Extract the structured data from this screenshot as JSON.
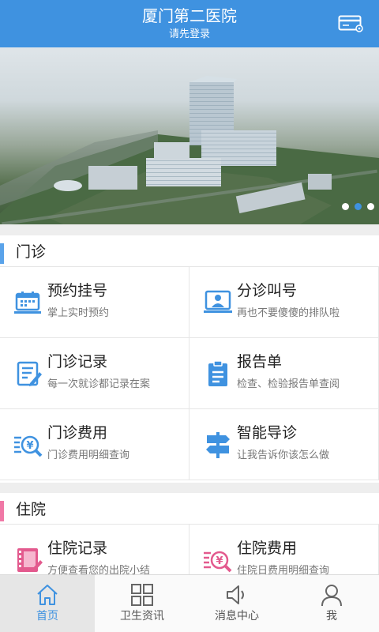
{
  "header": {
    "title": "厦门第二医院",
    "subtitle": "请先登录",
    "card_icon": "card-icon"
  },
  "banner": {
    "slide_count": 3,
    "active_slide": 2
  },
  "colors": {
    "primary": "#3f92e0",
    "outpatient_bar": "#5aa3ea",
    "inpatient_bar": "#f078a6",
    "inpatient_icon": "#e35a8e"
  },
  "outpatient": {
    "label": "门诊",
    "items": [
      {
        "title": "预约挂号",
        "subtitle": "掌上实时预约",
        "icon": "calendar-icon"
      },
      {
        "title": "分诊叫号",
        "subtitle": "再也不要傻傻的排队啦",
        "icon": "queue-icon"
      },
      {
        "title": "门诊记录",
        "subtitle": "每一次就诊都记录在案",
        "icon": "record-icon"
      },
      {
        "title": "报告单",
        "subtitle": "检查、检验报告单查阅",
        "icon": "report-icon"
      },
      {
        "title": "门诊费用",
        "subtitle": "门诊费用明细查询",
        "icon": "fee-search-icon"
      },
      {
        "title": "智能导诊",
        "subtitle": "让我告诉你该怎么做",
        "icon": "signpost-icon"
      }
    ]
  },
  "inpatient": {
    "label": "住院",
    "items": [
      {
        "title": "住院记录",
        "subtitle": "方便查看您的出院小结",
        "icon": "film-icon"
      },
      {
        "title": "住院费用",
        "subtitle": "住院日费用明细查询",
        "icon": "fee-search-icon"
      }
    ]
  },
  "nav": [
    {
      "label": "首页",
      "icon": "home-icon",
      "active": true
    },
    {
      "label": "卫生资讯",
      "icon": "grid-icon",
      "active": false
    },
    {
      "label": "消息中心",
      "icon": "speaker-icon",
      "active": false
    },
    {
      "label": "我",
      "icon": "user-icon",
      "active": false
    }
  ]
}
